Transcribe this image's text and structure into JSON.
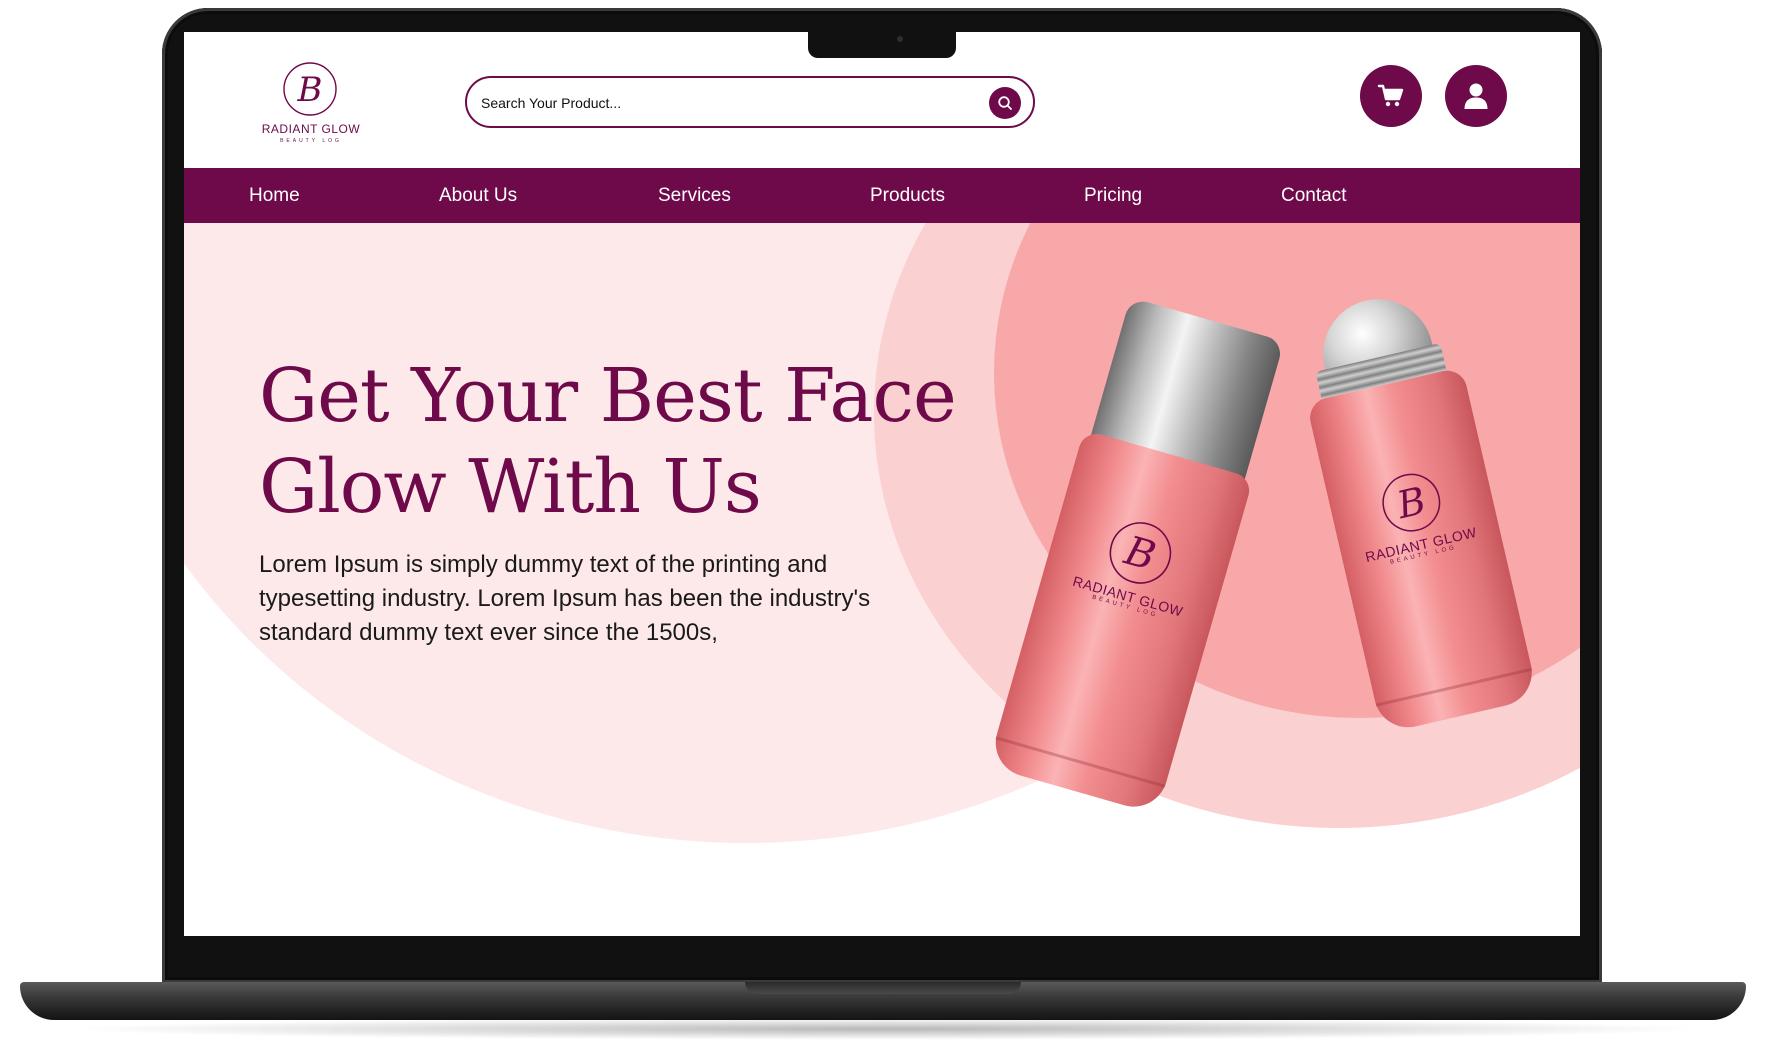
{
  "brand": {
    "name": "RADIANT GLOW",
    "tagline": "BEAUTY LOG",
    "monogram": "B",
    "primary_color": "#6e0a4a",
    "hero_bg_color": "#fde9ea",
    "accent_circle_color": "#f9a8aa"
  },
  "search": {
    "placeholder": "Search Your Product...",
    "icon": "search-icon"
  },
  "header_actions": {
    "cart_icon": "cart-icon",
    "user_icon": "user-icon"
  },
  "nav": {
    "items": [
      {
        "label": "Home"
      },
      {
        "label": "About Us"
      },
      {
        "label": "Services"
      },
      {
        "label": "Products"
      },
      {
        "label": "Pricing"
      },
      {
        "label": "Contact"
      }
    ]
  },
  "hero": {
    "title_line1": "Get Your Best Face",
    "title_line2": "Glow With Us",
    "description_line1": "Lorem Ipsum is simply dummy text of the printing and",
    "description_line2": "typesetting industry. Lorem Ipsum has been the industry's",
    "description_line3": "standard dummy text ever since the 1500s,"
  },
  "products_image": {
    "bottle_left_label": "RADIANT GLOW",
    "bottle_left_tag": "BEAUTY LOG",
    "bottle_right_label": "RADIANT GLOW",
    "bottle_right_tag": "BEAUTY LOG"
  }
}
